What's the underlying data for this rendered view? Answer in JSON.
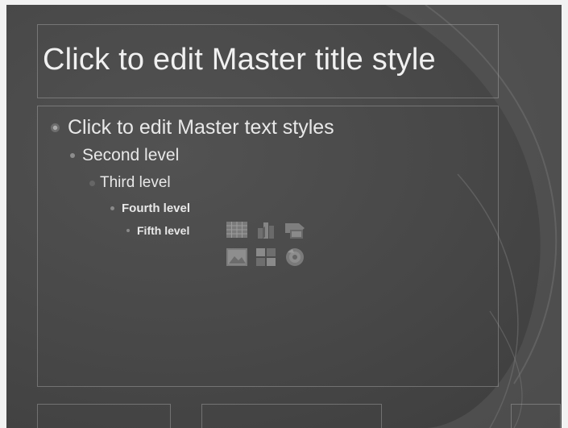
{
  "slide": {
    "title": "Click to edit Master title style",
    "levels": [
      "Click to edit Master text styles",
      "Second level",
      "Third level",
      "Fourth level",
      "Fifth level"
    ],
    "content_icons": [
      "insert-table-icon",
      "insert-chart-icon",
      "insert-smartart-icon",
      "insert-picture-icon",
      "insert-clipart-icon",
      "insert-media-icon"
    ]
  },
  "colors": {
    "background": "#474747",
    "text": "#f0f0f0",
    "placeholder_border": "#c8c8c8"
  }
}
